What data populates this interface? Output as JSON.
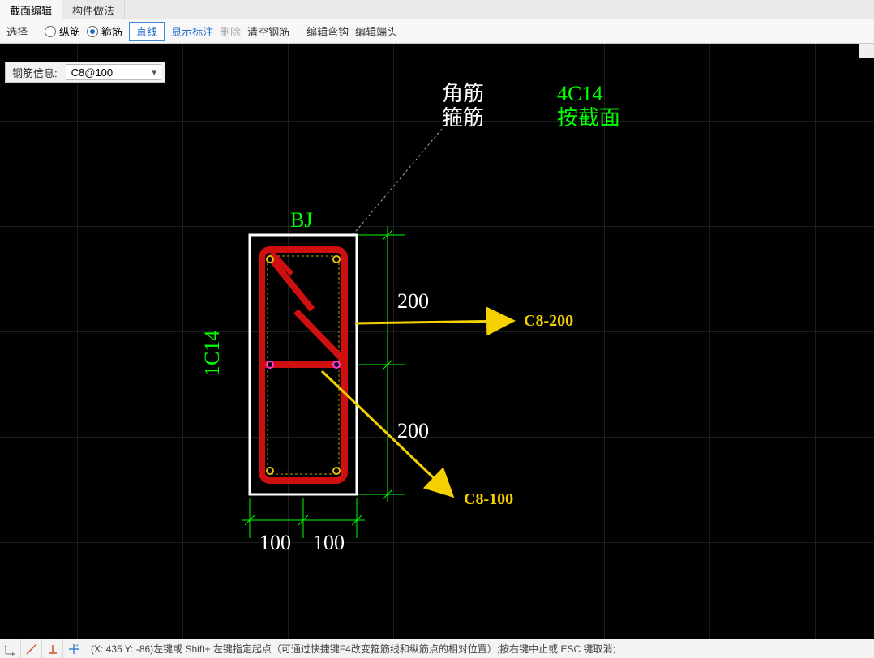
{
  "tabs": [
    {
      "label": "截面编辑",
      "active": true
    },
    {
      "label": "构件做法",
      "active": false
    }
  ],
  "toolbar": {
    "select_label": "选择",
    "radio_long": "纵筋",
    "radio_stirrup": "箍筋",
    "straight_button": "直线",
    "show_label": "显示标注",
    "delete": "删除",
    "clear": "清空钢筋",
    "edit_hook": "编辑弯钩",
    "edit_end": "编辑端头"
  },
  "infobar": {
    "label": "钢筋信息:",
    "value": "C8@100"
  },
  "overlay": {
    "corner_rebar": "角筋",
    "stirrup_rebar": "箍筋",
    "spec": "4C14",
    "by_section": "按截面",
    "bj": "BJ",
    "side_label": "1C14",
    "dims": {
      "v1": "200",
      "v2": "200",
      "h1": "100",
      "h2": "100"
    },
    "callout1": "C8-200",
    "callout2": "C8-100"
  },
  "statusbar": {
    "text": "(X: 435 Y: -86)左键或 Shift+ 左键指定起点（可通过快捷键F4改变箍筋线和纵筋点的相对位置）;按右键中止或 ESC 键取消;"
  }
}
